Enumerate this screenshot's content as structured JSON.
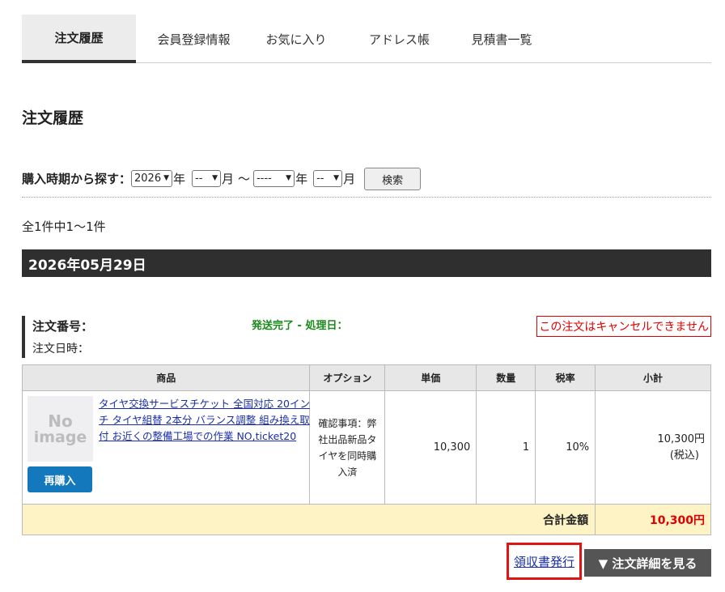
{
  "tabs": [
    {
      "label": "注文履歴",
      "active": true
    },
    {
      "label": "会員登録情報",
      "active": false
    },
    {
      "label": "お気に入り",
      "active": false
    },
    {
      "label": "アドレス帳",
      "active": false
    },
    {
      "label": "見積書一覧",
      "active": false
    }
  ],
  "page_title": "注文履歴",
  "search": {
    "label": "購入時期から探す：",
    "from_year": "2026",
    "from_year_unit": "年",
    "from_month": "--",
    "from_month_unit": "月",
    "separator": "〜",
    "to_year": "----",
    "to_year_unit": "年",
    "to_month": "--",
    "to_month_unit": "月",
    "button": "検索"
  },
  "count_text": "全1件中1〜1件",
  "date_header": "2026年05月29日",
  "order": {
    "number_label": "注文番号：",
    "date_label": "注文日時：",
    "status": "発送完了 - 処理日：",
    "cancel_note": "この注文はキャンセルできません"
  },
  "table": {
    "headers": [
      "商品",
      "オプション",
      "単価",
      "数量",
      "税率",
      "小計"
    ],
    "row": {
      "image_text_1": "No",
      "image_text_2": "image",
      "reorder": "再購入",
      "product_name": "タイヤ交換サービスチケット 全国対応 20インチ タイヤ組替 2本分 バランス調整 組み換え取付 お近くの整備工場での作業 NO,ticket20",
      "option": "確認事項：弊社出品新品タイヤを同時購入済",
      "unit_price": "10,300",
      "quantity": "1",
      "tax_rate": "10%",
      "subtotal": "10,300円",
      "subtotal_note": "(税込)"
    },
    "total_label": "合計金額",
    "total_value": "10,300円"
  },
  "actions": {
    "receipt": "領収書発行",
    "detail": "▼ 注文詳細を見る"
  },
  "colors": {
    "accent_green": "#1a8a1a",
    "alert_red": "#e10000",
    "button_blue": "#1478bd",
    "date_bar": "#2f2f2f",
    "total_bg": "#fdf3c5"
  }
}
